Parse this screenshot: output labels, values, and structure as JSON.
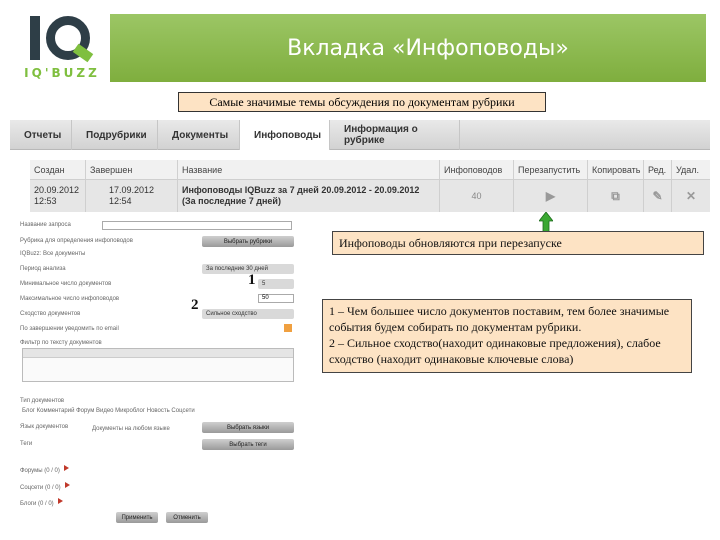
{
  "header": {
    "title": "Вкладка «Инфоповоды»",
    "logo_text": "IQ'BUZZ"
  },
  "callouts": {
    "top": "Самые значимые темы обсуждения по документам рубрики",
    "restart": "Инфоповоды обновляются при перезапуске",
    "legend_1": "1 – Чем большее число документов поставим, тем более значимые события будем собирать по документам рубрики.",
    "legend_2": "2 – Сильное сходство(находит одинаковые предложения), слабое сходство (находит одинаковые ключевые слова)",
    "marker_1": "1",
    "marker_2": "2"
  },
  "tabs": [
    {
      "label": "Отчеты"
    },
    {
      "label": "Подрубрики"
    },
    {
      "label": "Документы"
    },
    {
      "label": "Инфоповоды"
    },
    {
      "label": "Информация о рубрике"
    }
  ],
  "grid": {
    "headers": [
      "Создан",
      "Завершен",
      "Название",
      "Инфоповодов",
      "Перезапустить",
      "Копировать",
      "Ред.",
      "Удал."
    ],
    "row": {
      "created": "20.09.2012\n12:53",
      "finished": "17.09.2012\n12:54",
      "name": "Инфоповоды IQBuzz за 7 дней 20.09.2012 - 20.09.2012 (За последние 7 дней)",
      "count": "40"
    }
  },
  "form": {
    "lbl_query": "Название запроса",
    "lbl_rubric": "Рубрика для определения инфоповодов",
    "btn_rubric": "Выбрать рубрики",
    "rubric_value": "IQBuzz: Все документы",
    "lbl_period": "Период анализа",
    "sel_period": "За последние 30 дней",
    "lbl_mindocs": "Минимальное число документов",
    "sel_mindocs": "5",
    "lbl_maxevents": "Максимальное число инфоповодов",
    "val_maxevents": "50",
    "lbl_similarity": "Сходство документов",
    "sel_similarity": "Сильное сходство",
    "lbl_notify": "По завершении уведомить по email",
    "lbl_filter": "Фильтр по тексту документов",
    "lbl_doctypes": "Тип документов",
    "doctypes": "Блог  Комментарий  Форум  Видео  Микроблог  Новость  Соцсети",
    "lbl_lang": "Язык документов",
    "lang_value": "Документы на любом языке",
    "btn_lang": "Выбрать языки",
    "lbl_tags": "Теги",
    "btn_tags": "Выбрать теги",
    "lbl_forums": "Форумы  (0 / 0)",
    "lbl_social": "Соцсети (0 / 0)",
    "lbl_blogs": "Блоги (0 / 0)",
    "btn_apply": "Применить",
    "btn_cancel": "Отменить"
  }
}
